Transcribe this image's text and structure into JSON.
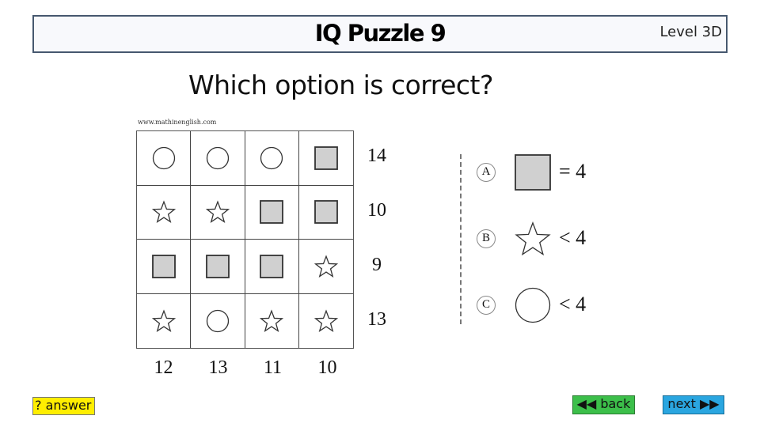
{
  "header": {
    "title": "IQ Puzzle 9",
    "level": "Level 3D"
  },
  "question": "Which option is correct?",
  "puzzle": {
    "watermark": "www.mathinenglish.com",
    "grid": [
      [
        "circle",
        "circle",
        "circle",
        "square"
      ],
      [
        "star",
        "star",
        "square",
        "square"
      ],
      [
        "square",
        "square",
        "square",
        "star"
      ],
      [
        "star",
        "circle",
        "star",
        "star"
      ]
    ],
    "row_sums": [
      "14",
      "10",
      "9",
      "13"
    ],
    "col_sums": [
      "12",
      "13",
      "11",
      "10"
    ],
    "colors": {
      "square_fill": "#d0d0d0",
      "stroke": "#333333"
    }
  },
  "options": [
    {
      "letter": "A",
      "shape": "square",
      "relation": "= 4"
    },
    {
      "letter": "B",
      "shape": "star",
      "relation": "< 4"
    },
    {
      "letter": "C",
      "shape": "circle",
      "relation": "< 4"
    }
  ],
  "buttons": {
    "answer": "? answer",
    "back": "◀◀ back",
    "next": "next ▶▶"
  },
  "colors": {
    "answer_bg": "#ffee00",
    "back_bg": "#3cbf4a",
    "next_bg": "#2aa6e0",
    "title_border": "#46586f"
  }
}
